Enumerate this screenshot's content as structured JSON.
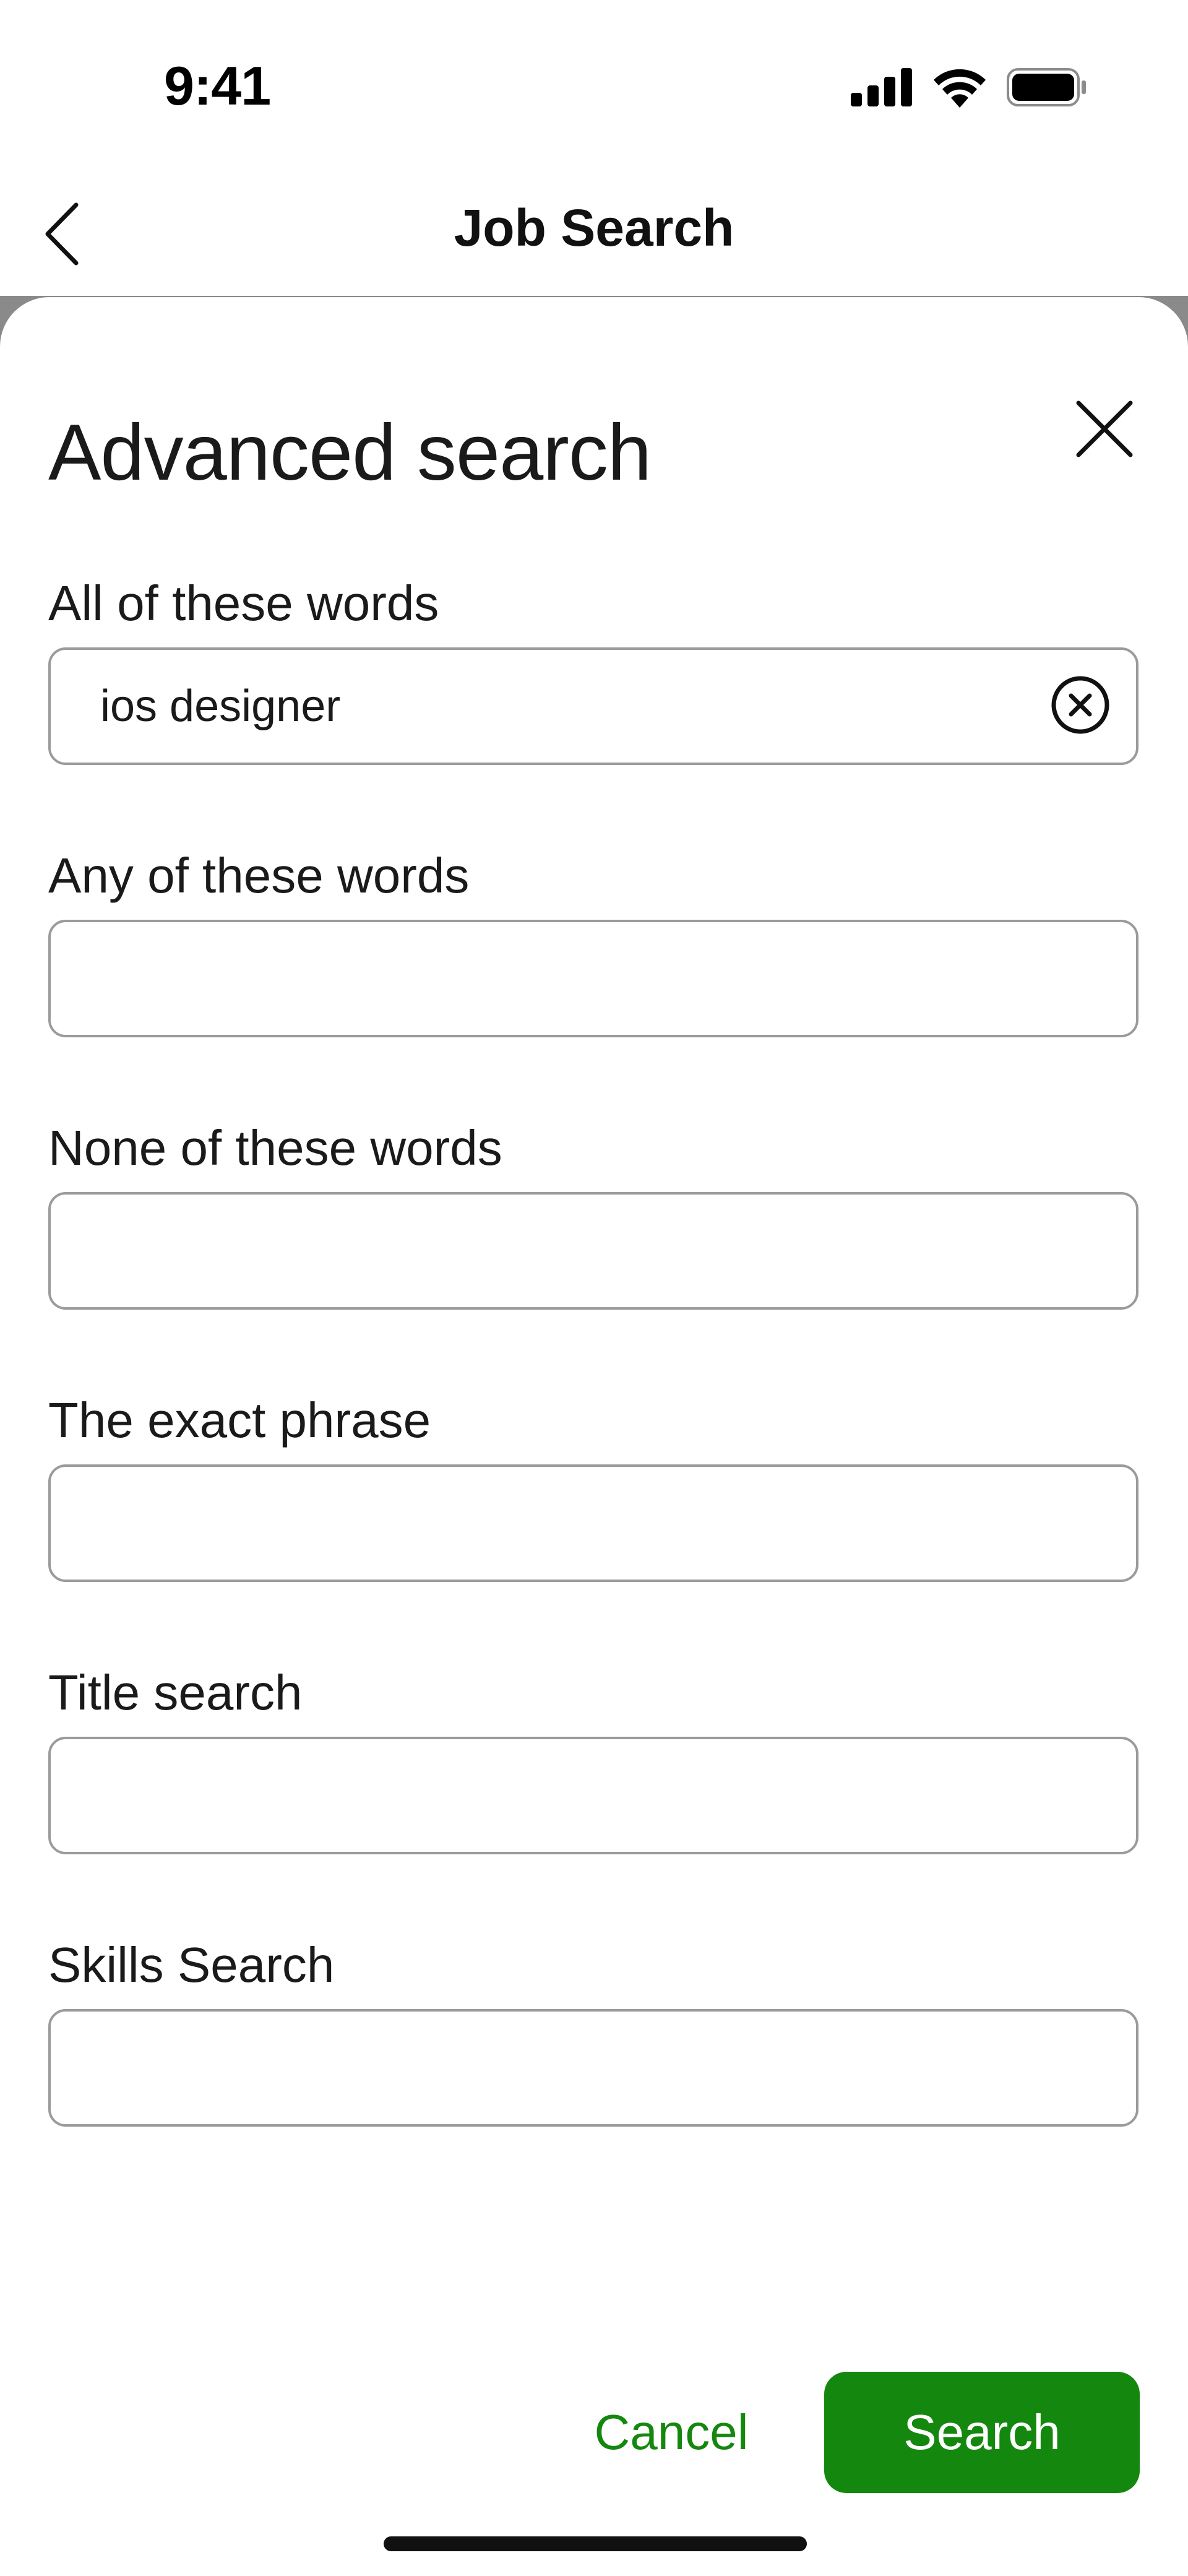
{
  "status_bar": {
    "time": "9:41",
    "icons": [
      "cellular-signal-icon",
      "wifi-icon",
      "battery-icon"
    ]
  },
  "nav": {
    "title": "Job Search",
    "back_icon": "chevron-left-icon"
  },
  "sheet": {
    "title": "Advanced search",
    "close_icon": "close-icon",
    "fields": [
      {
        "label": "All of these words",
        "value": "ios designer",
        "has_clear": true
      },
      {
        "label": "Any of these words",
        "value": ""
      },
      {
        "label": "None of these words",
        "value": ""
      },
      {
        "label": "The exact phrase",
        "value": ""
      },
      {
        "label": "Title search",
        "value": ""
      },
      {
        "label": "Skills Search",
        "value": ""
      }
    ]
  },
  "actions": {
    "cancel_label": "Cancel",
    "search_label": "Search"
  },
  "colors": {
    "accent": "#14880e",
    "border": "#9b9b9b",
    "backdrop": "#8a8a8a"
  }
}
